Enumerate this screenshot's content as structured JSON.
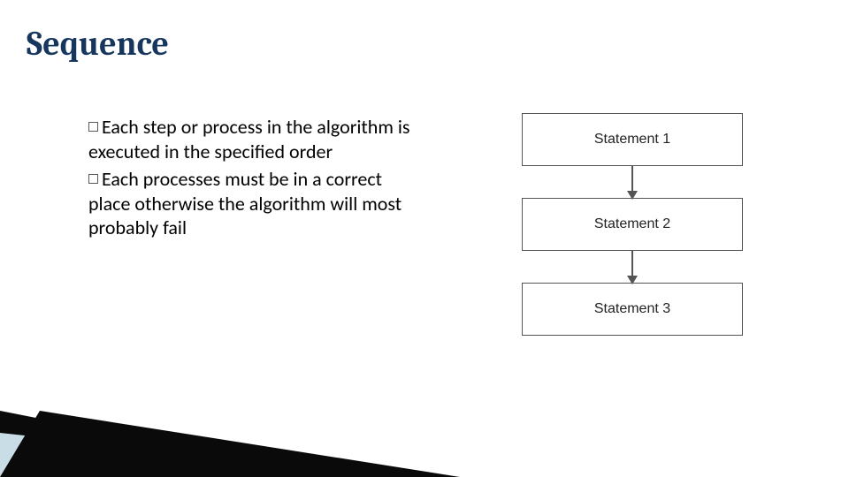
{
  "title": "Sequence",
  "bullets": [
    "Each step or process in the algorithm is executed in the specified order",
    "Each processes must be in a correct place otherwise the algorithm will most probably fail"
  ],
  "diagram": {
    "boxes": [
      "Statement 1",
      "Statement 2",
      "Statement 3"
    ]
  }
}
